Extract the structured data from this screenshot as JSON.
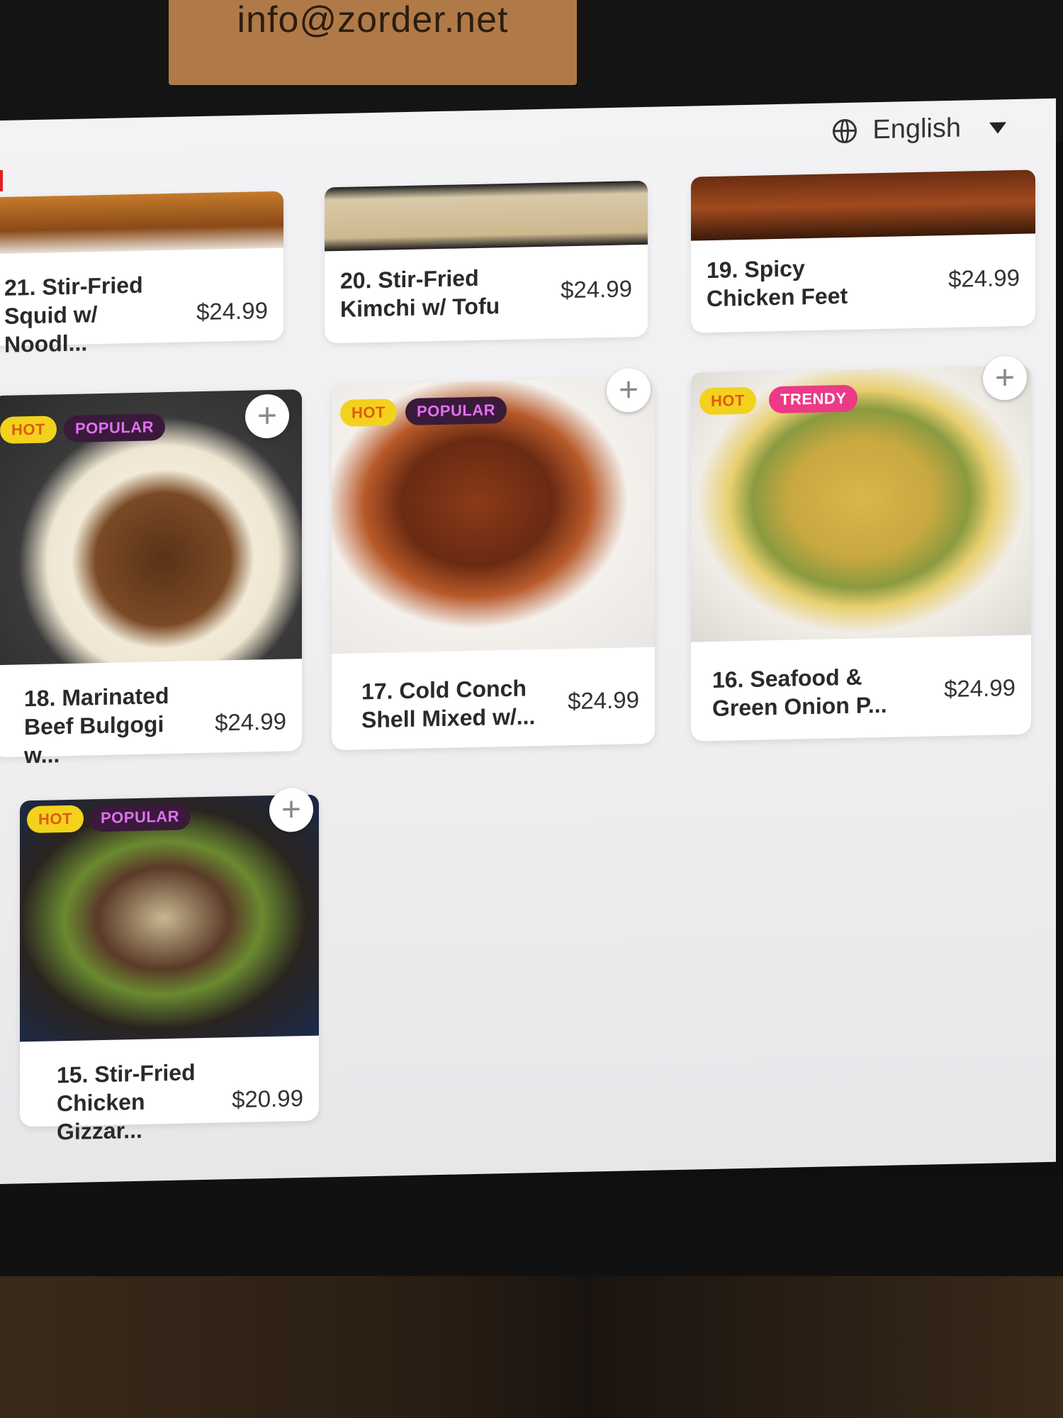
{
  "sticker": {
    "text": "info@zorder.net"
  },
  "header": {
    "language": "English"
  },
  "tags": {
    "hot": "HOT",
    "popular": "POPULAR",
    "trendy": "TRENDY"
  },
  "colors": {
    "hot_bg": "#f2d21d",
    "popular_bg": "#3a1a3a",
    "trendy_bg": "#ec3a86"
  },
  "items": [
    {
      "name": "21. Stir-Fried Squid w/ Noodl...",
      "price": "$24.99"
    },
    {
      "name": "20. Stir-Fried Kimchi w/ Tofu",
      "price": "$24.99"
    },
    {
      "name": "19. Spicy Chicken Feet",
      "price": "$24.99"
    },
    {
      "name": "18. Marinated Beef Bulgogi w...",
      "price": "$24.99",
      "tags": [
        "HOT",
        "POPULAR"
      ]
    },
    {
      "name": "17. Cold Conch Shell Mixed w/...",
      "price": "$24.99",
      "tags": [
        "HOT",
        "POPULAR"
      ]
    },
    {
      "name": "16. Seafood & Green Onion P...",
      "price": "$24.99",
      "tags": [
        "HOT",
        "TRENDY"
      ]
    },
    {
      "name": "15. Stir-Fried Chicken Gizzar...",
      "price": "$20.99",
      "tags": [
        "HOT",
        "POPULAR"
      ]
    }
  ]
}
